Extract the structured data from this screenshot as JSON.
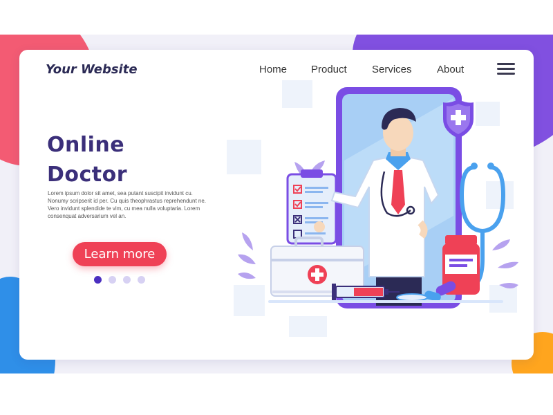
{
  "header": {
    "brand": "Your Website",
    "nav": [
      {
        "label": "Home"
      },
      {
        "label": "Product"
      },
      {
        "label": "Services"
      },
      {
        "label": "About"
      }
    ],
    "menu_icon": "hamburger-menu-icon"
  },
  "hero": {
    "title_line1": "Online",
    "title_line2": "Doctor",
    "body": "Lorem ipsum dolor sit amet, sea putant suscipit invidunt cu. Nonumy scripserit id per. Cu quis theophrastus reprehendunt ne. Vero invidunt splendide te vim, cu mea nulla voluptaria. Lorem consenquat adversarium vel an.",
    "cta_label": "Learn more",
    "carousel": {
      "count": 4,
      "active_index": 0
    }
  },
  "illustration": {
    "subject": "doctor-on-phone-illustration",
    "icons": [
      "shield-cross-icon",
      "stethoscope-icon",
      "medical-kit-icon",
      "clipboard-checklist-icon",
      "syringe-icon",
      "medicine-bottle-icon",
      "pills-icon"
    ]
  },
  "colors": {
    "accent_red": "#ef4156",
    "brand_purple": "#3b2f7a",
    "dot_active": "#4b2fc0",
    "dot_inactive": "#d7d1f3",
    "blob_red": "#f35b73",
    "blob_purple": "#8150e0",
    "blob_blue": "#2f8fe8",
    "blob_orange": "#ffa51e"
  }
}
